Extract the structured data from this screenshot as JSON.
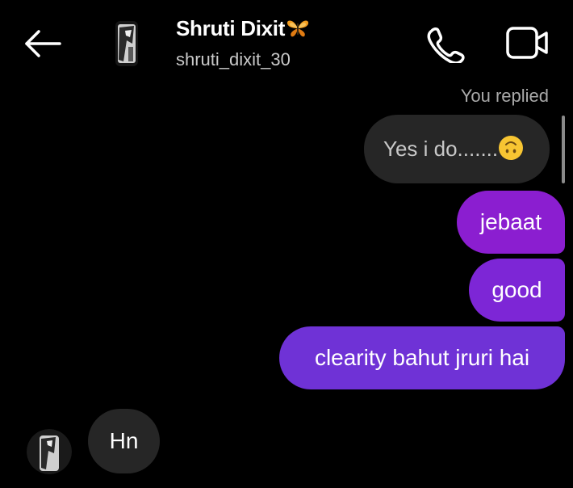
{
  "header": {
    "name": "Shruti Dixit",
    "username": "shruti_dixit_30",
    "icons": [
      "back-arrow-icon",
      "butterfly-icon",
      "phone-icon",
      "video-call-icon"
    ]
  },
  "thread": {
    "reply_label": "You replied",
    "replied_message": "Yes i do.......",
    "sent_messages": [
      "jebaat",
      "good",
      "clearity bahut jruri hai"
    ],
    "received_message": "Hn"
  },
  "colors": {
    "background": "#000000",
    "bubble_gray": "#262626",
    "sent_gradient": [
      "#8b1ed0",
      "#6f32d6"
    ]
  }
}
